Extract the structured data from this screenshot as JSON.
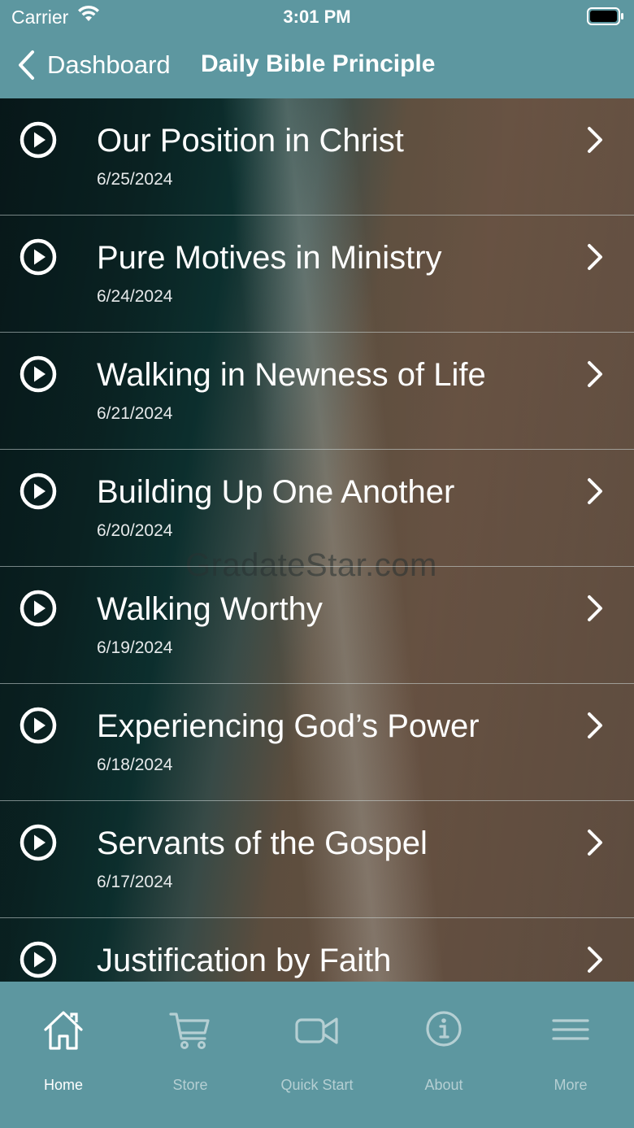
{
  "status_bar": {
    "carrier": "Carrier",
    "time": "3:01 PM"
  },
  "nav": {
    "back_label": "Dashboard",
    "title": "Daily Bible Principle"
  },
  "watermark": "GradateStar.com",
  "items": [
    {
      "title": "Our Position in Christ",
      "date": "6/25/2024"
    },
    {
      "title": "Pure Motives in Ministry",
      "date": "6/24/2024"
    },
    {
      "title": "Walking in Newness of Life",
      "date": "6/21/2024"
    },
    {
      "title": "Building Up One Another",
      "date": "6/20/2024"
    },
    {
      "title": "Walking Worthy",
      "date": "6/19/2024"
    },
    {
      "title": "Experiencing God’s Power",
      "date": "6/18/2024"
    },
    {
      "title": "Servants of the Gospel",
      "date": "6/17/2024"
    },
    {
      "title": "Justification by Faith",
      "date": ""
    }
  ],
  "tabs": [
    {
      "label": "Home",
      "icon": "home-icon",
      "active": true
    },
    {
      "label": "Store",
      "icon": "cart-icon",
      "active": false
    },
    {
      "label": "Quick Start",
      "icon": "video-icon",
      "active": false
    },
    {
      "label": "About",
      "icon": "info-icon",
      "active": false
    },
    {
      "label": "More",
      "icon": "menu-icon",
      "active": false
    }
  ],
  "colors": {
    "bar": "#5d97a0",
    "active_tab": "#ffffff",
    "inactive_tab": "#b5cfd3"
  }
}
